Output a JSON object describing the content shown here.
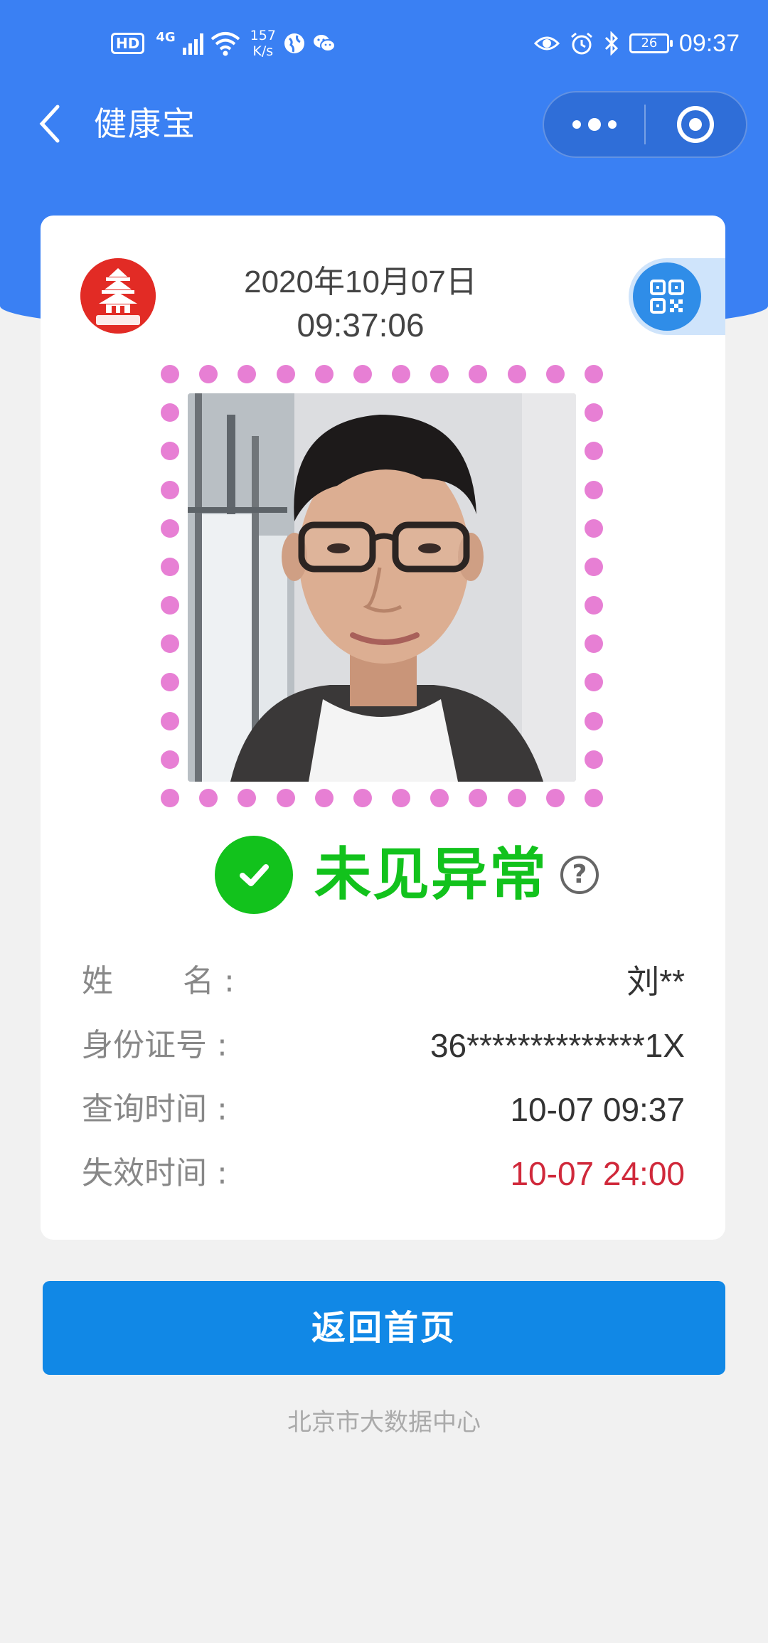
{
  "status_bar": {
    "left": {
      "hd": "HD",
      "network": "4G",
      "speed_value": "157",
      "speed_unit": "K/s"
    },
    "right": {
      "battery": "26",
      "time": "09:37"
    }
  },
  "nav": {
    "title": "健康宝"
  },
  "card": {
    "date": "2020年10月07日",
    "time": "09:37:06",
    "status": "未见异常",
    "help": "?",
    "info": {
      "name_label_1": "姓",
      "name_label_2": "名",
      "name_value": "刘**",
      "id_label": "身份证号",
      "id_value": "36**************1X",
      "query_label": "查询时间",
      "query_value": "10-07 09:37",
      "expire_label": "失效时间",
      "expire_value": "10-07 24:00",
      "colon": ":"
    }
  },
  "home_button": "返回首页",
  "footer": "北京市大数据中心",
  "colors": {
    "header_blue": "#3a80f3",
    "status_green": "#12c21c",
    "expire_red": "#d0293b",
    "button_blue": "#1188e6",
    "frame_pink": "#e77fd4"
  }
}
